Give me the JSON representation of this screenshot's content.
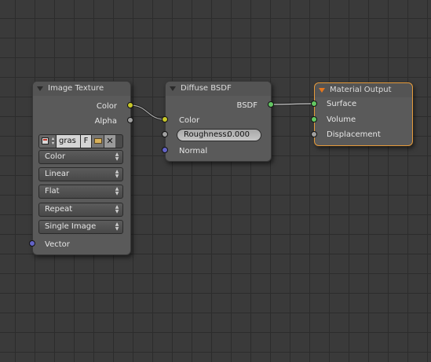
{
  "nodes": {
    "image_texture": {
      "title": "Image Texture",
      "outputs": {
        "color": "Color",
        "alpha": "Alpha"
      },
      "image": {
        "name": "gras",
        "fake_user": "F"
      },
      "dropdowns": {
        "color_space": "Color",
        "interpolation": "Linear",
        "projection": "Flat",
        "extension": "Repeat",
        "source": "Single Image"
      },
      "inputs": {
        "vector": "Vector"
      }
    },
    "diffuse_bsdf": {
      "title": "Diffuse BSDF",
      "outputs": {
        "bsdf": "BSDF"
      },
      "inputs": {
        "color": "Color",
        "roughness_label": "Roughness:",
        "roughness_value": "0.000",
        "normal": "Normal"
      }
    },
    "material_output": {
      "title": "Material Output",
      "inputs": {
        "surface": "Surface",
        "volume": "Volume",
        "displacement": "Displacement"
      }
    }
  },
  "socket_colors": {
    "color": "#c7c729",
    "float": "#a1a1a1",
    "shader": "#63c763",
    "vector": "#6363c7"
  },
  "accent_color": "#e59a3a",
  "icons": {
    "collapse": "triangle-down-icon",
    "image_browse": "image-browse-icon",
    "open_file": "folder-icon",
    "unlink": "close-icon",
    "dropdown": "up-down-arrows-icon"
  }
}
